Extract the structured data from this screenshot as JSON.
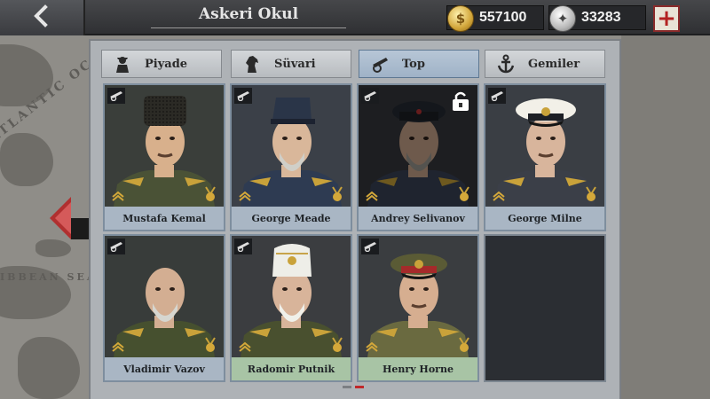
{
  "header": {
    "title": "Askeri Okul",
    "gold": "557100",
    "silver": "33283",
    "gold_icon": "gold-coin-icon",
    "silver_icon": "silver-medal-icon",
    "back_icon": "back-arrow-icon",
    "plus_icon": "plus-icon"
  },
  "map": {
    "labels": [
      "ATLANTIC OC",
      "IBBEAN SEA"
    ]
  },
  "tabs": [
    {
      "label": "Piyade",
      "icon": "infantry-soldier-icon",
      "active": false
    },
    {
      "label": "Süvari",
      "icon": "cavalry-horse-icon",
      "active": false
    },
    {
      "label": "Top",
      "icon": "artillery-cannon-icon",
      "active": true
    },
    {
      "label": "Gemiler",
      "icon": "anchor-icon",
      "active": false
    }
  ],
  "generals": [
    {
      "name": "Mustafa Kemal",
      "locked": false,
      "highlight": false
    },
    {
      "name": "George Meade",
      "locked": false,
      "highlight": false
    },
    {
      "name": "Andrey Selivanov",
      "locked": true,
      "highlight": false
    },
    {
      "name": "George Milne",
      "locked": false,
      "highlight": false
    },
    {
      "name": "Vladimir Vazov",
      "locked": false,
      "highlight": false
    },
    {
      "name": "Radomir Putnik",
      "locked": false,
      "highlight": true
    },
    {
      "name": "Henry Horne",
      "locked": false,
      "highlight": true
    }
  ],
  "colors": {
    "accent_red": "#b32222",
    "name_plate_blue": "#a9b6c4",
    "name_plate_green": "#a8c4a5",
    "active_tab": "#9fb2c7"
  },
  "pager": {
    "pages": 2,
    "current": 2
  }
}
